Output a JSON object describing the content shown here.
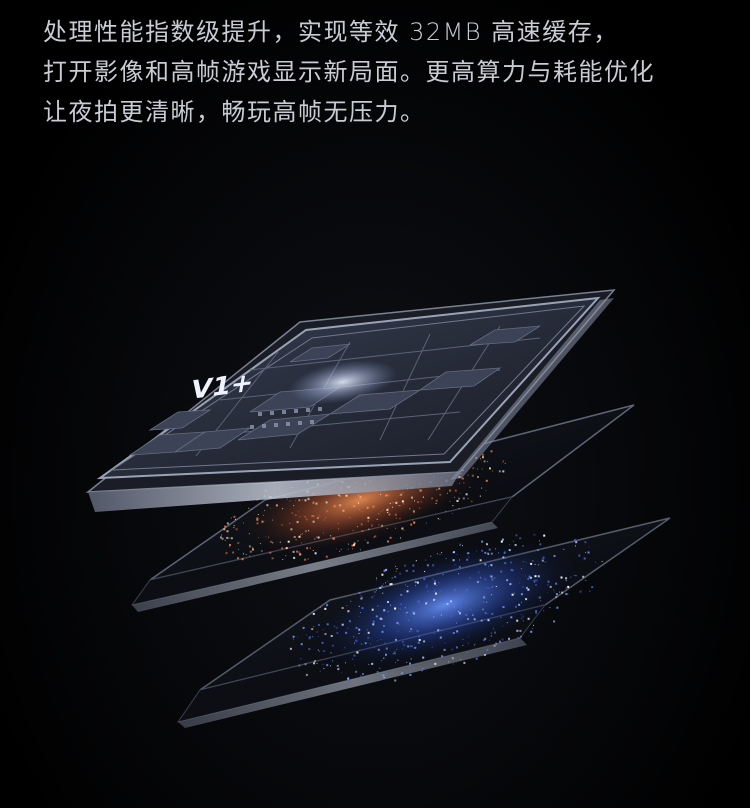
{
  "description_text": {
    "line1": "处理性能指数级提升，实现等效 32MB 高速缓存，",
    "line2": "打开影像和高帧游戏显示新局面。更高算力与耗能优化",
    "line3": "让夜拍更清晰，畅玩高帧无压力。"
  },
  "chip": {
    "logo_text": "V1+"
  },
  "colors": {
    "background": "#000000",
    "text": "#c9ccd3",
    "chip_frame": "#9aa3b5",
    "orange_particles": "#ff8a4a",
    "blue_particles": "#4a7dff"
  }
}
